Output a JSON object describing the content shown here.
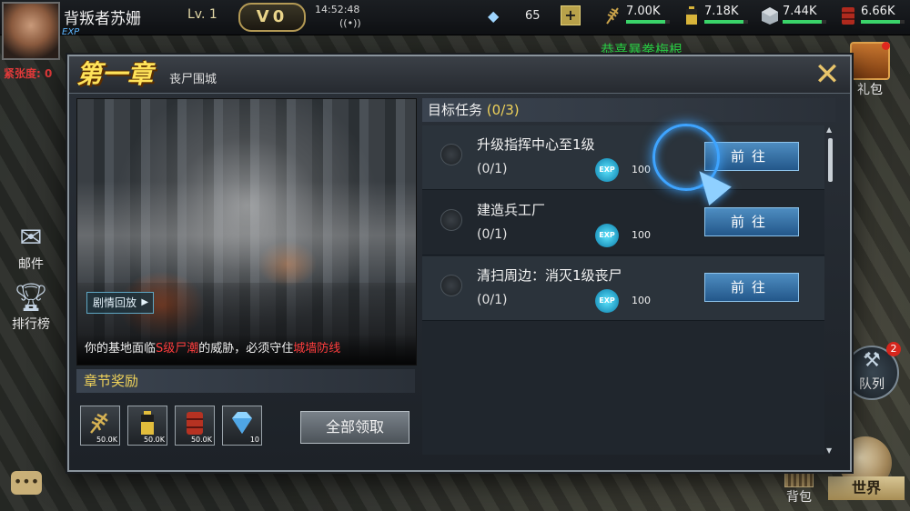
{
  "player": {
    "name": "背叛者苏姗",
    "level_label": "Lv.",
    "level": "1",
    "vip": "V0",
    "exp_label": "EXP"
  },
  "status": {
    "time": "14:52:48"
  },
  "resources": {
    "gems": "65",
    "items": [
      {
        "icon": "wheat-icon",
        "value": "7.00K",
        "color": "#c8a24a",
        "fill": 0.9
      },
      {
        "icon": "battery-icon",
        "value": "7.18K",
        "color": "#d8b43a",
        "fill": 0.9
      },
      {
        "icon": "steel-cube-icon",
        "value": "7.44K",
        "color": "#a9b3bb",
        "fill": 0.9
      },
      {
        "icon": "oil-barrel-icon",
        "value": "6.66K",
        "color": "#b02a1e",
        "fill": 0.9
      }
    ]
  },
  "hud": {
    "danger_text": "紧张度: 0",
    "announcement": "恭喜暴拳梅根",
    "gift_label": "礼包",
    "mail_label": "邮件",
    "ranking_label": "排行榜",
    "queue_label": "队列",
    "queue_badge": "2",
    "bag_label": "背包",
    "world_label": "世界"
  },
  "dialog": {
    "chapter": "第一章",
    "subtitle": "丧尸围城",
    "replay_label": "剧情回放",
    "story": {
      "prefix": "你的基地面临",
      "hl1": "S级尸潮",
      "middle": "的威胁，必须守住",
      "hl2": "城墙防线"
    },
    "reward_title": "章节奖励",
    "rewards": [
      {
        "icon": "wheat-icon",
        "count": "50.0K"
      },
      {
        "icon": "battery-icon",
        "count": "50.0K"
      },
      {
        "icon": "oil-barrel-icon",
        "count": "50.0K"
      },
      {
        "icon": "diamond-icon",
        "count": "10"
      }
    ],
    "claim_all_label": "全部领取",
    "tasks_title": "目标任务",
    "tasks_count": "(0/3)",
    "tasks": [
      {
        "title": "升级指挥中心至1级",
        "progress": "(0/1)",
        "exp_icon": "EXP",
        "exp": "100",
        "go_label": "前往"
      },
      {
        "title": "建造兵工厂",
        "progress": "(0/1)",
        "exp_icon": "EXP",
        "exp": "100",
        "go_label": "前往"
      },
      {
        "title": "清扫周边：消灭1级丧尸",
        "progress": "(0/1)",
        "exp_icon": "EXP",
        "exp": "100",
        "go_label": "前往"
      }
    ]
  }
}
